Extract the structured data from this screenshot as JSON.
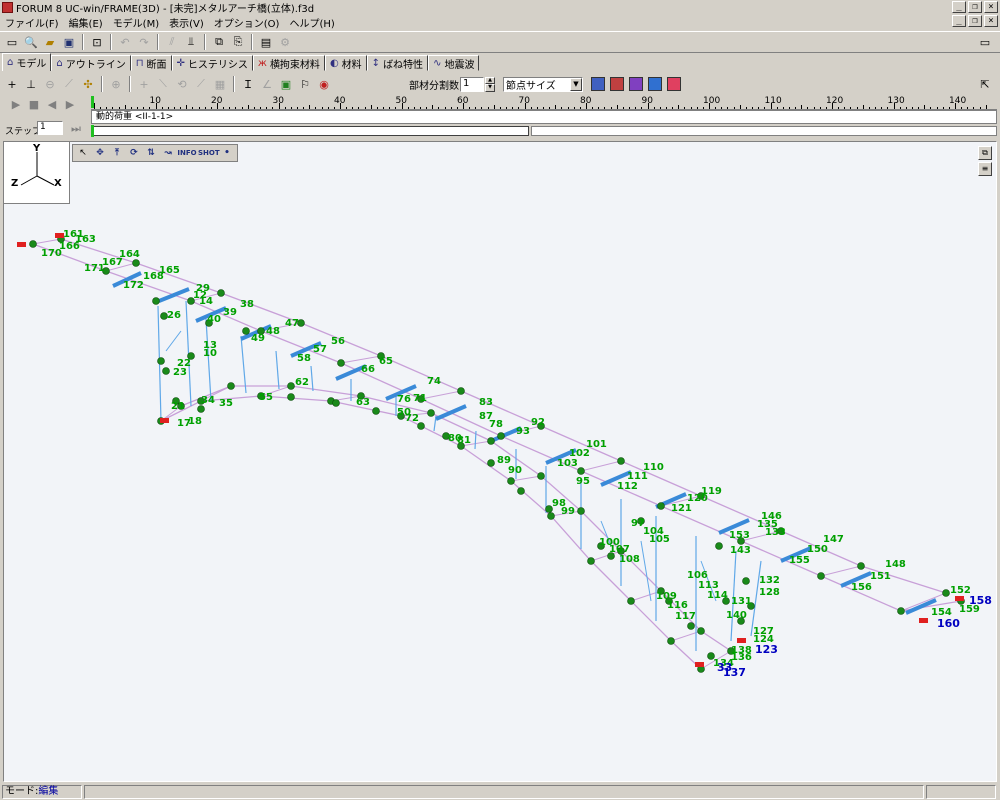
{
  "window": {
    "title": "FORUM 8  UC-win/FRAME(3D) - [未完]メタルアーチ橋(立体).f3d",
    "min": "_",
    "restore": "❐",
    "close": "×"
  },
  "menu": [
    "ファイル(F)",
    "編集(E)",
    "モデル(M)",
    "表示(V)",
    "オプション(O)",
    "ヘルプ(H)"
  ],
  "toolbar": {
    "icons": [
      "new-icon",
      "open-icon",
      "folder-icon",
      "save-icon",
      "preview-icon",
      "undo-icon",
      "redo-icon",
      "pause-icon",
      "split-icon",
      "copy-icon",
      "paste-icon",
      "calc-icon",
      "disabled-icon"
    ]
  },
  "tabs": [
    {
      "label": "モデル",
      "icon": "model-tab-icon",
      "active": true
    },
    {
      "label": "アウトライン",
      "icon": "outline-tab-icon"
    },
    {
      "label": "断面",
      "icon": "section-tab-icon"
    },
    {
      "label": "ヒステリシス",
      "icon": "hysteresis-tab-icon"
    },
    {
      "label": "横拘束材料",
      "icon": "restraint-tab-icon"
    },
    {
      "label": "材料",
      "icon": "material-tab-icon"
    },
    {
      "label": "ばね特性",
      "icon": "spring-tab-icon"
    },
    {
      "label": "地震波",
      "icon": "wave-tab-icon"
    }
  ],
  "modelbar": {
    "divisions_label": "部材分割数",
    "divisions_value": "1",
    "node_size": "節点サイズ"
  },
  "timeline": {
    "ruler_ticks": [
      "10",
      "20",
      "30",
      "40",
      "50",
      "60",
      "70",
      "80",
      "90",
      "100",
      "110",
      "120",
      "130",
      "140"
    ],
    "load_case": "動的荷重 <II-1-1>",
    "step_label": "ステップ*:",
    "step_value": "1"
  },
  "axes": {
    "y": "Y",
    "z": "Z",
    "x": "X"
  },
  "viewtools": [
    "↖",
    "✥",
    "⤒",
    "⟳",
    "⇅",
    "↝",
    "INFO",
    "SHOT",
    "•"
  ],
  "labels": {
    "green": [
      {
        "t": "161"
      },
      {
        "t": "163"
      },
      {
        "t": "166"
      },
      {
        "t": "170"
      },
      {
        "t": "164"
      },
      {
        "t": "167"
      },
      {
        "t": "171"
      },
      {
        "t": "165"
      },
      {
        "t": "168"
      },
      {
        "t": "172"
      },
      {
        "t": "29"
      },
      {
        "t": "12"
      },
      {
        "t": "14"
      },
      {
        "t": "26"
      },
      {
        "t": "38"
      },
      {
        "t": "39"
      },
      {
        "t": "40"
      },
      {
        "t": "47"
      },
      {
        "t": "48"
      },
      {
        "t": "49"
      },
      {
        "t": "13"
      },
      {
        "t": "10"
      },
      {
        "t": "56"
      },
      {
        "t": "57"
      },
      {
        "t": "58"
      },
      {
        "t": "23"
      },
      {
        "t": "22"
      },
      {
        "t": "65"
      },
      {
        "t": "66"
      },
      {
        "t": "74"
      },
      {
        "t": "62"
      },
      {
        "t": "55"
      },
      {
        "t": "35"
      },
      {
        "t": "34"
      },
      {
        "t": "21"
      },
      {
        "t": "18"
      },
      {
        "t": "17"
      },
      {
        "t": "83"
      },
      {
        "t": "76"
      },
      {
        "t": "71"
      },
      {
        "t": "72"
      },
      {
        "t": "63"
      },
      {
        "t": "50"
      },
      {
        "t": "87"
      },
      {
        "t": "78"
      },
      {
        "t": "92"
      },
      {
        "t": "93"
      },
      {
        "t": "81"
      },
      {
        "t": "80"
      },
      {
        "t": "101"
      },
      {
        "t": "102"
      },
      {
        "t": "103"
      },
      {
        "t": "89"
      },
      {
        "t": "90"
      },
      {
        "t": "110"
      },
      {
        "t": "111"
      },
      {
        "t": "112"
      },
      {
        "t": "95"
      },
      {
        "t": "98"
      },
      {
        "t": "99"
      },
      {
        "t": "119"
      },
      {
        "t": "120"
      },
      {
        "t": "121"
      },
      {
        "t": "97"
      },
      {
        "t": "104"
      },
      {
        "t": "105"
      },
      {
        "t": "100"
      },
      {
        "t": "107"
      },
      {
        "t": "108"
      },
      {
        "t": "146"
      },
      {
        "t": "135"
      },
      {
        "t": "133"
      },
      {
        "t": "153"
      },
      {
        "t": "143"
      },
      {
        "t": "147"
      },
      {
        "t": "150"
      },
      {
        "t": "155"
      },
      {
        "t": "106"
      },
      {
        "t": "113"
      },
      {
        "t": "114"
      },
      {
        "t": "109"
      },
      {
        "t": "116"
      },
      {
        "t": "117"
      },
      {
        "t": "132"
      },
      {
        "t": "128"
      },
      {
        "t": "131"
      },
      {
        "t": "140"
      },
      {
        "t": "148"
      },
      {
        "t": "151"
      },
      {
        "t": "156"
      },
      {
        "t": "127"
      },
      {
        "t": "124"
      },
      {
        "t": "152"
      },
      {
        "t": "159"
      },
      {
        "t": "154"
      },
      {
        "t": "136"
      },
      {
        "t": "138"
      },
      {
        "t": "134"
      }
    ],
    "blue": [
      {
        "t": "158"
      },
      {
        "t": "160"
      },
      {
        "t": "123"
      },
      {
        "t": "137"
      },
      {
        "t": "33"
      }
    ]
  },
  "status": {
    "mode_label": "モード:",
    "mode_value": "編集"
  },
  "colors": {
    "chord": "#c8a0d8",
    "hanger": "#60a8e8",
    "node": "#1a8a1a",
    "label_green": "#00a000",
    "label_blue": "#0000c0",
    "support": "#e02020",
    "beam": "#3a8ad8"
  }
}
